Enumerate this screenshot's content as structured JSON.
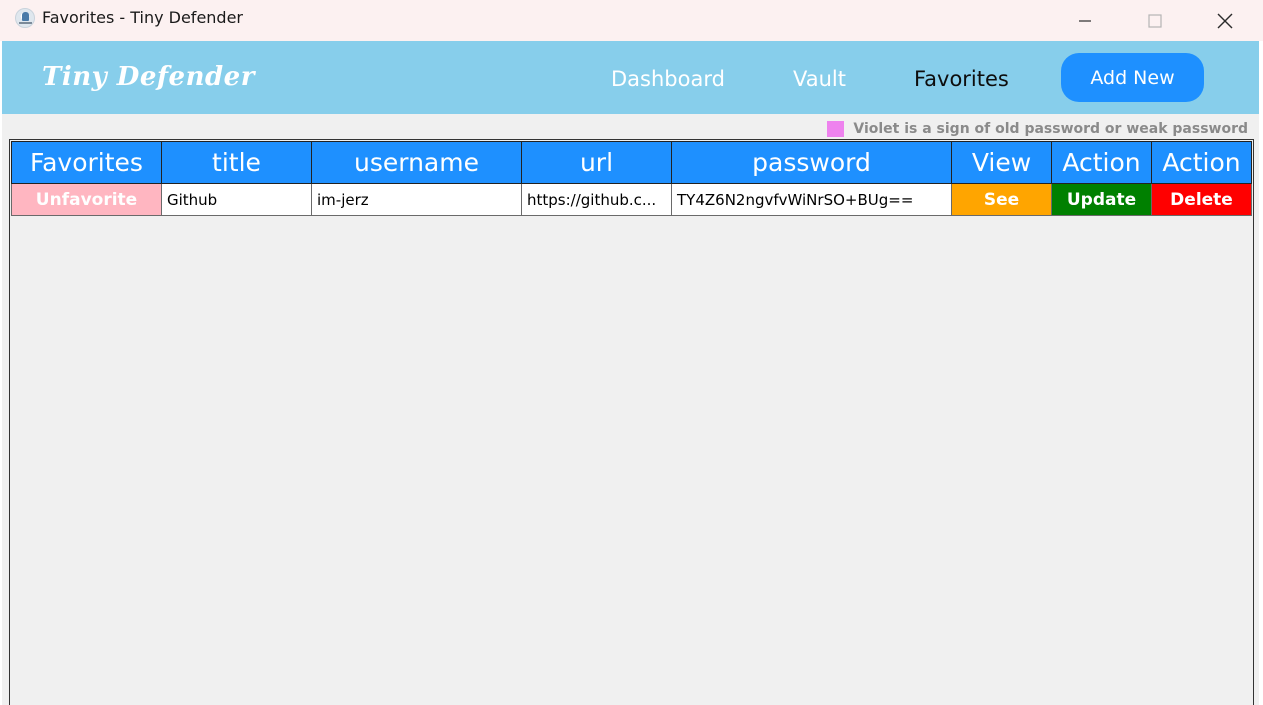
{
  "window": {
    "title": "Favorites - Tiny Defender",
    "icon": "tiny-defender-app-icon",
    "controls": [
      "minimize-icon",
      "maximize-icon",
      "close-icon"
    ]
  },
  "header": {
    "brand": "Tiny Defender",
    "nav": {
      "dashboard": "Dashboard",
      "vault": "Vault",
      "favorites": "Favorites"
    },
    "add_new": "Add New",
    "active_nav": "favorites"
  },
  "legend": {
    "text": "Violet is a sign of old password or weak password",
    "swatch_color": "#ee82ee"
  },
  "table": {
    "headers": [
      "Favorites",
      "title",
      "username",
      "url",
      "password",
      "View",
      "Action",
      "Action"
    ],
    "rows": [
      {
        "favorite_action": "Unfavorite",
        "title": "Github",
        "username": "im-jerz",
        "url": "https://github.c...",
        "password": "TY4Z6N2ngvfvWiNrSO+BUg==",
        "view_action": "See",
        "update_action": "Update",
        "delete_action": "Delete"
      }
    ]
  },
  "colors": {
    "header_bar": "#87ceeb",
    "primary_blue": "#1e90ff",
    "unfavorite": "#ffb6c1",
    "see": "#ffa500",
    "update": "#008000",
    "delete": "#ff0000",
    "content_bg": "#f0f0f0"
  }
}
